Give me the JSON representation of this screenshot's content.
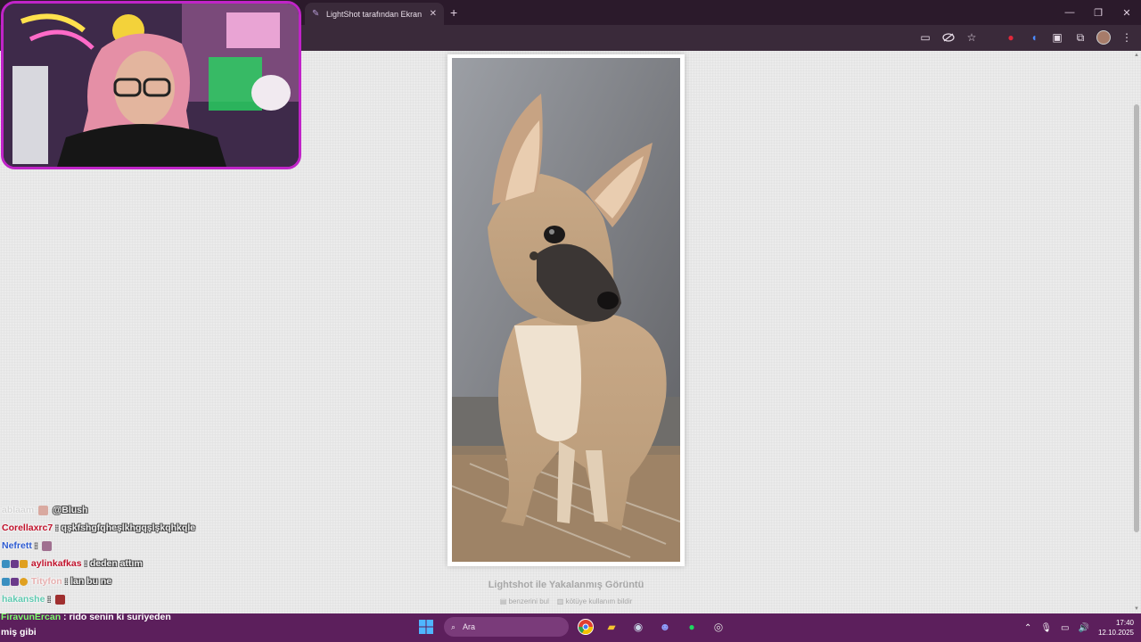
{
  "browser": {
    "tab_title": "LightShot tarafından Ekran Görüntüsü",
    "new_tab": "+",
    "close": "✕",
    "window": {
      "minimize": "—",
      "maximize": "❐",
      "close": "✕"
    }
  },
  "page": {
    "caption": "Lightshot ile Yakalanmış Görüntü",
    "link_similar": "benzerini bul",
    "link_report": "kötüye kullanım bildir"
  },
  "chat": [
    {
      "user": "ablaam",
      "color": "#d6d6d6",
      "message": "@Blush"
    },
    {
      "user": "Corellaxrc7",
      "color": "#c0102a",
      "message": ": qşkfshgfqheşlkhgqşlşkqhkqle"
    },
    {
      "user": "Nefrett",
      "color": "#2c5ad0",
      "message": ":"
    },
    {
      "user": "aylinkafkas",
      "color": "#c0102a",
      "message": ": deden attım"
    },
    {
      "user": "Tityfon",
      "color": "#e7b0b0",
      "message": ": lan bu ne"
    },
    {
      "user": "hakanshe",
      "color": "#5fc9b0",
      "message": ":"
    }
  ],
  "strip": {
    "user": "FiravunErcan",
    "message": ": rido senin ki suriyeden",
    "message2": "miş gibi"
  },
  "taskbar": {
    "search_placeholder": "Ara",
    "time": "17:40",
    "date": "12.10.2025"
  }
}
